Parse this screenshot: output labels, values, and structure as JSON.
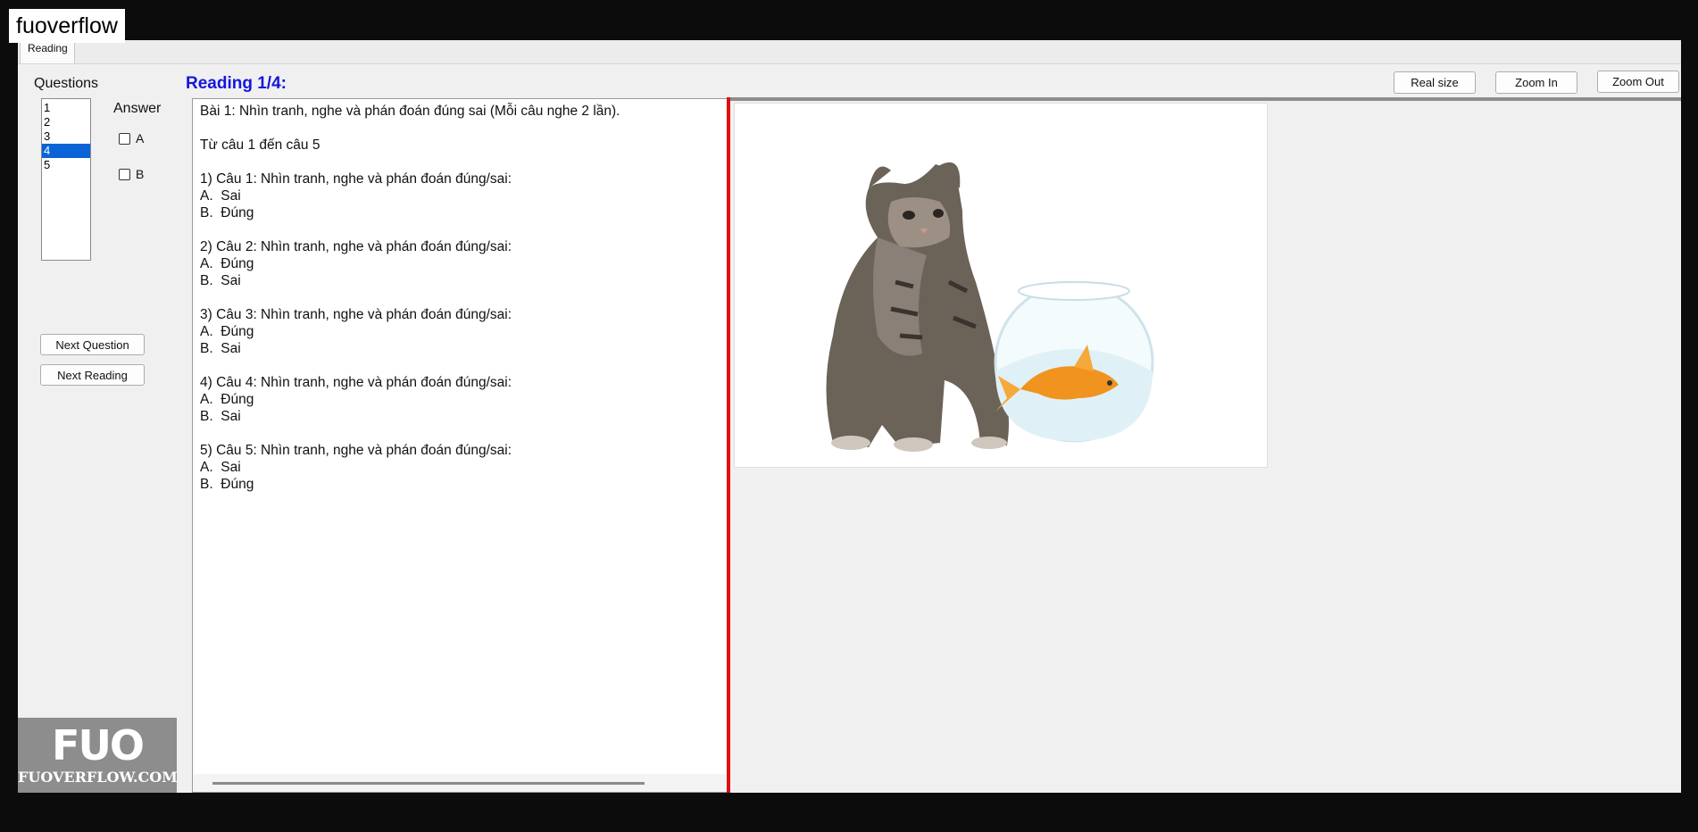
{
  "watermark": {
    "text": "fuoverflow",
    "logo_text": "FUO",
    "logo_sub": "FUOVERFLOW.COM"
  },
  "tab": {
    "label": "Reading"
  },
  "questions": {
    "label": "Questions",
    "items": [
      "1",
      "2",
      "3",
      "4",
      "5"
    ],
    "selected": "4"
  },
  "answer": {
    "label": "Answer",
    "options": [
      {
        "label": "A",
        "checked": false
      },
      {
        "label": "B",
        "checked": false
      }
    ]
  },
  "buttons": {
    "next_question": "Next Question",
    "next_reading": "Next Reading",
    "real_size": "Real size",
    "zoom_in": "Zoom In",
    "zoom_out": "Zoom Out"
  },
  "reading": {
    "title": "Reading 1/4:",
    "lines": [
      "Bài 1: Nhìn tranh, nghe và phán đoán đúng sai (Mỗi câu nghe 2 lần).",
      "",
      "Từ câu 1 đến câu 5",
      "",
      "1) Câu 1: Nhìn tranh, nghe và phán đoán đúng/sai:",
      "A.  Sai",
      "B.  Đúng",
      "",
      "2) Câu 2: Nhìn tranh, nghe và phán đoán đúng/sai:",
      "A.  Đúng",
      "B.  Sai",
      "",
      "3) Câu 3: Nhìn tranh, nghe và phán đoán đúng/sai:",
      "A.  Đúng",
      "B.  Sai",
      "",
      "4) Câu 4: Nhìn tranh, nghe và phán đoán đúng/sai:",
      "A.  Đúng",
      "B.  Sai",
      "",
      "5) Câu 5: Nhìn tranh, nghe và phán đoán đúng/sai:",
      "A.  Sai",
      "B.  Đúng"
    ]
  },
  "colors": {
    "accent": "#1515e0",
    "splitter": "#e01010",
    "selection": "#0a64d8"
  }
}
